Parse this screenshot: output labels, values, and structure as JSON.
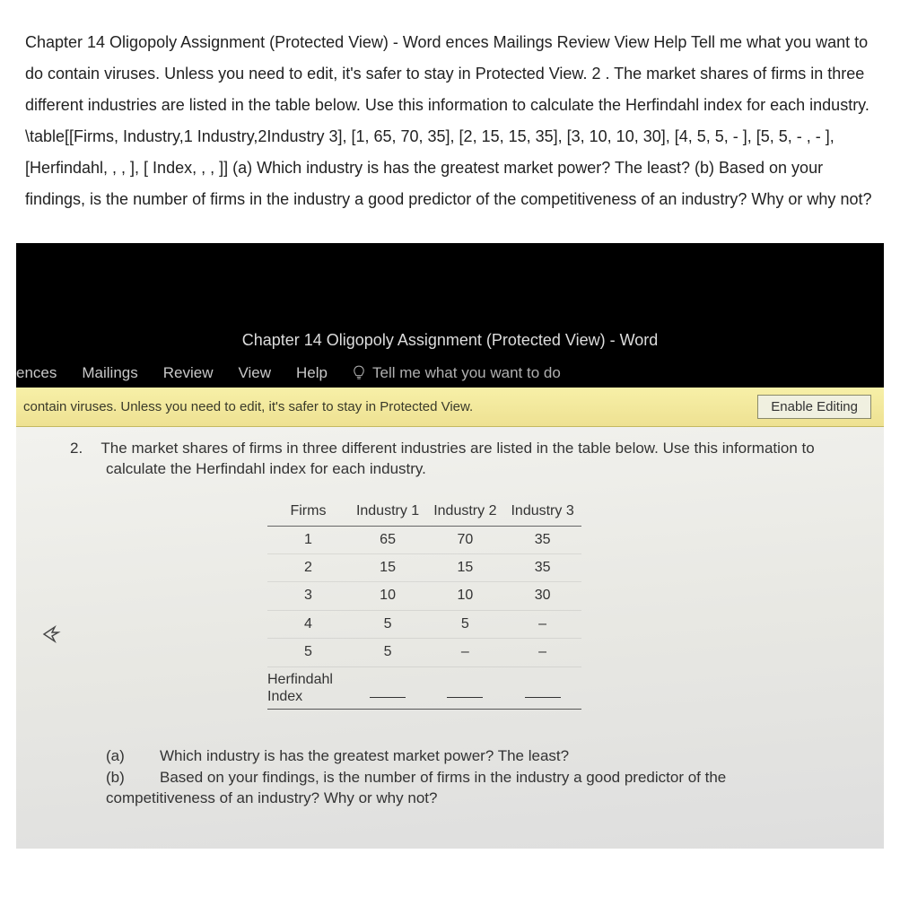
{
  "question_text": "Chapter 14 Oligopoly Assignment (Protected View) - Word ences Mailings Review View Help Tell me what you want to do contain viruses. Unless you need to edit, it's safer to stay in Protected View. 2 . The market shares of firms in three different industries are listed in the table below. Use this information to calculate the Herfindahl index for each industry. \\table[[Firms, Industry,1 Industry,2Industry 3], [1, 65, 70, 35], [2, 15, 15, 35], [3, 10, 10, 30], [4, 5, 5, - ], [5, 5, - , - ], [Herfindahl, , , ], [ Index, , , ]] (a) Which industry is has the greatest market power? The least? (b) Based on your findings, is the number of firms in the industry a good predictor of the competitiveness of an industry? Why or why not?",
  "word": {
    "title": "Chapter 14 Oligopoly Assignment (Protected View) - Word",
    "tabs": {
      "ences": "ences",
      "mailings": "Mailings",
      "review": "Review",
      "view": "View",
      "help": "Help",
      "tellme": "Tell me what you want to do"
    },
    "protected": {
      "msg": "contain viruses. Unless you need to edit, it's safer to stay in Protected View.",
      "button": "Enable Editing"
    }
  },
  "doc": {
    "q_num": "2.",
    "q_intro": "The market shares of firms in three different industries are listed in the table below.  Use this information to calculate the Herfindahl index for each industry.",
    "table": {
      "headers": {
        "firms": "Firms",
        "ind1": "Industry 1",
        "ind2": "Industry 2",
        "ind3": "Industry 3"
      },
      "rows": [
        {
          "firm": "1",
          "i1": "65",
          "i2": "70",
          "i3": "35"
        },
        {
          "firm": "2",
          "i1": "15",
          "i2": "15",
          "i3": "35"
        },
        {
          "firm": "3",
          "i1": "10",
          "i2": "10",
          "i3": "30"
        },
        {
          "firm": "4",
          "i1": "5",
          "i2": "5",
          "i3": "–"
        },
        {
          "firm": "5",
          "i1": "5",
          "i2": "–",
          "i3": "–"
        }
      ],
      "herf_label_1": "Herfindahl",
      "herf_label_2": "Index"
    },
    "sub": {
      "a_label": "(a)",
      "a_text": "Which industry is has the greatest market power?  The least?",
      "b_label": "(b)",
      "b_text": "Based on your findings, is the number of firms in the industry a good predictor of the",
      "b_cont": "competitiveness of an industry?  Why or why not?"
    }
  }
}
